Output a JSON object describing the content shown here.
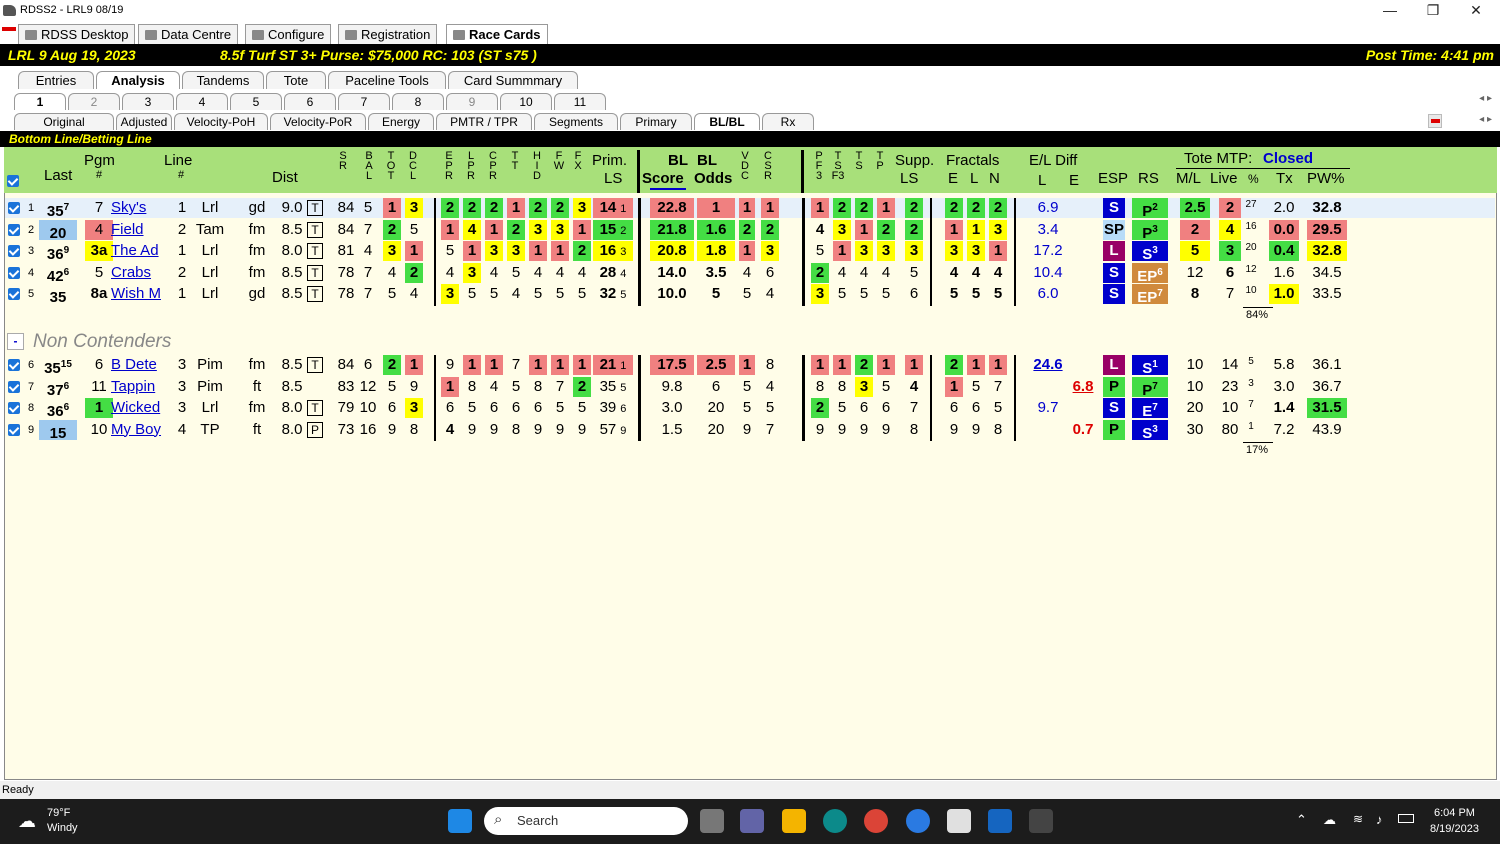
{
  "window": {
    "title": "RDSS2 - LRL9  08/19",
    "min": "—",
    "max": "❐",
    "close": "✕"
  },
  "main_tabs": [
    "RDSS Desktop",
    "Data Centre",
    "Configure",
    "Registration",
    "Race Cards"
  ],
  "race": {
    "track_race": "LRL  9  Aug 19, 2023",
    "conditions": "8.5f  Turf  ST  3+   Purse: $75,000   RC: 103  (ST s75 )",
    "post_time": "Post Time: 4:41 pm"
  },
  "view_tabs": [
    "Entries",
    "Analysis",
    "Tandems",
    "Tote",
    "Paceline Tools",
    "Card Summmary"
  ],
  "race_tabs": [
    "1",
    "2",
    "3",
    "4",
    "5",
    "6",
    "7",
    "8",
    "9",
    "10",
    "11"
  ],
  "analysis_tabs": [
    "Original",
    "Adjusted",
    "Velocity-PoH",
    "Velocity-PoR",
    "Energy",
    "PMTR / TPR",
    "Segments",
    "Primary",
    "BL/BL",
    "Rx"
  ],
  "section_title": "Bottom Line/Betting Line",
  "headers": {
    "last": "Last",
    "pgm": "Pgm",
    "pgm_hash": "#",
    "line": "Line",
    "line_hash": "#",
    "dist": "Dist",
    "sr": "S R",
    "bal": "B A L",
    "tot": "T O T",
    "dcl": "D C L",
    "epr": "E P R",
    "lpr": "L P R",
    "cpr": "C P R",
    "tt": "T T",
    "hid": "H I D",
    "fw": "F W",
    "fx": "F X",
    "prim": "Prim.",
    "prim_ls": "LS",
    "bl": "BL",
    "bl2": "BL",
    "score": "Score",
    "odds": "Odds",
    "vdc": "V D C",
    "csr": "C S R",
    "pf3": "P F 3",
    "tsf3": "T S F3",
    "ts": "T S",
    "tp": "T P",
    "supp": "Supp.",
    "supp_ls": "LS",
    "fractals": "Fractals",
    "e": "E",
    "l": "L",
    "n": "N",
    "eldiff": "E/L Diff",
    "eld_l": "L",
    "eld_e": "E",
    "esp": "ESP",
    "rs": "RS",
    "tote": "Tote MTP:",
    "tote_status": "Closed",
    "ml": "M/L",
    "live": "Live",
    "pct": "%",
    "tx": "Tx",
    "pw": "PW%"
  },
  "contenders": [
    {
      "n": "1",
      "last": "35",
      "last_sup": "7",
      "pgm": "7",
      "name": "Sky's",
      "line": "1",
      "trk": "Lrl",
      "cond": "gd",
      "dist": "9.0",
      "surf": "T",
      "sr": "84",
      "bal": "5",
      "tot": "1",
      "dcl": "3",
      "epr": "2",
      "lpr": "2",
      "cpr": "2",
      "tt": "1",
      "hid": "2",
      "fw": "2",
      "fx": "3",
      "prim": "14",
      "prim_r": "1",
      "score": "22.8",
      "odds": "1",
      "vdc": "1",
      "csr": "1",
      "pf3": "1",
      "tsf3": "2",
      "ts": "2",
      "tp": "1",
      "supp": "2",
      "fe": "2",
      "fl": "2",
      "fn": "2",
      "eld_l": "6.9",
      "eld_e": "",
      "esp": "S",
      "rs": "P",
      "rs_sup": "2",
      "ml": "2.5",
      "live": "2",
      "pct": "27",
      "tx": "2.0",
      "pw": "32.8"
    },
    {
      "n": "2",
      "last": "20",
      "last_sup": "",
      "pgm": "4",
      "name": "Field",
      "line": "2",
      "trk": "Tam",
      "cond": "fm",
      "dist": "8.5",
      "surf": "T",
      "sr": "84",
      "bal": "7",
      "tot": "2",
      "dcl": "5",
      "epr": "1",
      "lpr": "4",
      "cpr": "1",
      "tt": "2",
      "hid": "3",
      "fw": "3",
      "fx": "1",
      "prim": "15",
      "prim_r": "2",
      "score": "21.8",
      "odds": "1.6",
      "vdc": "2",
      "csr": "2",
      "pf3": "4",
      "tsf3": "3",
      "ts": "1",
      "tp": "2",
      "supp": "2",
      "fe": "1",
      "fl": "1",
      "fn": "3",
      "eld_l": "3.4",
      "eld_e": "",
      "esp": "SP",
      "rs": "P",
      "rs_sup": "3",
      "ml": "2",
      "live": "4",
      "pct": "16",
      "tx": "0.0",
      "pw": "29.5"
    },
    {
      "n": "3",
      "last": "36",
      "last_sup": "9",
      "pgm": "3a",
      "name": "The Ad",
      "line": "1",
      "trk": "Lrl",
      "cond": "fm",
      "dist": "8.0",
      "surf": "T",
      "sr": "81",
      "bal": "4",
      "tot": "3",
      "dcl": "1",
      "epr": "5",
      "lpr": "1",
      "cpr": "3",
      "tt": "3",
      "hid": "1",
      "fw": "1",
      "fx": "2",
      "prim": "16",
      "prim_r": "3",
      "score": "20.8",
      "odds": "1.8",
      "vdc": "1",
      "csr": "3",
      "pf3": "5",
      "tsf3": "1",
      "ts": "3",
      "tp": "3",
      "supp": "3",
      "fe": "3",
      "fl": "3",
      "fn": "1",
      "eld_l": "17.2",
      "eld_e": "",
      "esp": "L",
      "rs": "S",
      "rs_sup": "3",
      "ml": "5",
      "live": "3",
      "pct": "20",
      "tx": "0.4",
      "pw": "32.8"
    },
    {
      "n": "4",
      "last": "42",
      "last_sup": "6",
      "pgm": "5",
      "name": "Crabs",
      "line": "2",
      "trk": "Lrl",
      "cond": "fm",
      "dist": "8.5",
      "surf": "T",
      "sr": "78",
      "bal": "7",
      "tot": "4",
      "dcl": "2",
      "epr": "4",
      "lpr": "3",
      "cpr": "4",
      "tt": "5",
      "hid": "4",
      "fw": "4",
      "fx": "4",
      "prim": "28",
      "prim_r": "4",
      "score": "14.0",
      "odds": "3.5",
      "vdc": "4",
      "csr": "6",
      "pf3": "2",
      "tsf3": "4",
      "ts": "4",
      "tp": "4",
      "supp": "5",
      "fe": "4",
      "fl": "4",
      "fn": "4",
      "eld_l": "10.4",
      "eld_e": "",
      "esp": "S",
      "rs": "EP",
      "rs_sup": "6",
      "ml": "12",
      "live": "6",
      "pct": "12",
      "tx": "1.6",
      "pw": "34.5"
    },
    {
      "n": "5",
      "last": "35",
      "last_sup": "",
      "pgm": "8a",
      "name": "Wish M",
      "line": "1",
      "trk": "Lrl",
      "cond": "gd",
      "dist": "8.5",
      "surf": "T",
      "sr": "78",
      "bal": "7",
      "tot": "5",
      "dcl": "4",
      "epr": "3",
      "lpr": "5",
      "cpr": "5",
      "tt": "4",
      "hid": "5",
      "fw": "5",
      "fx": "5",
      "prim": "32",
      "prim_r": "5",
      "score": "10.0",
      "odds": "5",
      "vdc": "5",
      "csr": "4",
      "pf3": "3",
      "tsf3": "5",
      "ts": "5",
      "tp": "5",
      "supp": "6",
      "fe": "5",
      "fl": "5",
      "fn": "5",
      "eld_l": "6.0",
      "eld_e": "",
      "esp": "S",
      "rs": "EP",
      "rs_sup": "7",
      "ml": "8",
      "live": "7",
      "pct": "10",
      "tx": "1.0",
      "pw": "33.5"
    }
  ],
  "contender_pct_total": "84%",
  "non_contenders_label": "Non Contenders",
  "collapse_btn": "-",
  "non_contenders": [
    {
      "n": "6",
      "last": "35",
      "last_sup": "15",
      "pgm": "6",
      "name": "B Dete",
      "line": "3",
      "trk": "Pim",
      "cond": "fm",
      "dist": "8.5",
      "surf": "T",
      "sr": "84",
      "bal": "6",
      "tot": "2",
      "dcl": "1",
      "epr": "9",
      "lpr": "1",
      "cpr": "1",
      "tt": "7",
      "hid": "1",
      "fw": "1",
      "fx": "1",
      "prim": "21",
      "prim_r": "1",
      "score": "17.5",
      "odds": "2.5",
      "vdc": "1",
      "csr": "8",
      "pf3": "1",
      "tsf3": "1",
      "ts": "2",
      "tp": "1",
      "supp": "1",
      "fe": "2",
      "fl": "1",
      "fn": "1",
      "eld_l": "24.6",
      "eld_e": "",
      "esp": "L",
      "rs": "S",
      "rs_sup": "1",
      "ml": "10",
      "live": "14",
      "pct": "5",
      "tx": "5.8",
      "pw": "36.1"
    },
    {
      "n": "7",
      "last": "37",
      "last_sup": "6",
      "pgm": "11",
      "name": "Tappin",
      "line": "3",
      "trk": "Pim",
      "cond": "ft",
      "dist": "8.5",
      "surf": "",
      "sr": "83",
      "bal": "12",
      "tot": "5",
      "dcl": "9",
      "epr": "1",
      "lpr": "8",
      "cpr": "4",
      "tt": "5",
      "hid": "8",
      "fw": "7",
      "fx": "2",
      "prim": "35",
      "prim_r": "5",
      "score": "9.8",
      "odds": "6",
      "vdc": "5",
      "csr": "4",
      "pf3": "8",
      "tsf3": "8",
      "ts": "3",
      "tp": "5",
      "supp": "4",
      "fe": "1",
      "fl": "5",
      "fn": "7",
      "eld_l": "",
      "eld_e": "6.8",
      "esp": "P",
      "rs": "P",
      "rs_sup": "7",
      "ml": "10",
      "live": "23",
      "pct": "3",
      "tx": "3.0",
      "pw": "36.7"
    },
    {
      "n": "8",
      "last": "36",
      "last_sup": "6",
      "pgm": "1",
      "name": "Wicked",
      "line": "3",
      "trk": "Lrl",
      "cond": "fm",
      "dist": "8.0",
      "surf": "T",
      "sr": "79",
      "bal": "10",
      "tot": "6",
      "dcl": "3",
      "epr": "6",
      "lpr": "5",
      "cpr": "6",
      "tt": "6",
      "hid": "6",
      "fw": "5",
      "fx": "5",
      "prim": "39",
      "prim_r": "6",
      "score": "3.0",
      "odds": "20",
      "vdc": "5",
      "csr": "5",
      "pf3": "2",
      "tsf3": "5",
      "ts": "6",
      "tp": "6",
      "supp": "7",
      "fe": "6",
      "fl": "6",
      "fn": "5",
      "eld_l": "9.7",
      "eld_e": "",
      "esp": "S",
      "rs": "E",
      "rs_sup": "7",
      "ml": "20",
      "live": "10",
      "pct": "7",
      "tx": "1.4",
      "pw": "31.5"
    },
    {
      "n": "9",
      "last": "15",
      "last_sup": "",
      "pgm": "10",
      "name": "My Boy",
      "line": "4",
      "trk": "TP",
      "cond": "ft",
      "dist": "8.0",
      "surf": "P",
      "sr": "73",
      "bal": "16",
      "tot": "9",
      "dcl": "8",
      "epr": "4",
      "lpr": "9",
      "cpr": "9",
      "tt": "8",
      "hid": "9",
      "fw": "9",
      "fx": "9",
      "prim": "57",
      "prim_r": "9",
      "score": "1.5",
      "odds": "20",
      "vdc": "9",
      "csr": "7",
      "pf3": "9",
      "tsf3": "9",
      "ts": "9",
      "tp": "9",
      "supp": "8",
      "fe": "9",
      "fl": "9",
      "fn": "8",
      "eld_l": "",
      "eld_e": "0.7",
      "esp": "P",
      "rs": "S",
      "rs_sup": "3",
      "ml": "30",
      "live": "80",
      "pct": "1",
      "tx": "7.2",
      "pw": "43.9"
    }
  ],
  "noncontender_pct_total": "17%",
  "status": "Ready",
  "taskbar": {
    "temp": "79°F",
    "weather": "Windy",
    "search": "Search",
    "time": "6:04 PM",
    "date": "8/19/2023"
  },
  "colors": {
    "header_green": "#a8e07a",
    "content_bg": "#fffde8",
    "race_bar": "#000000",
    "race_text": "#ffff00",
    "red_cell": "#f08080",
    "yellow_cell": "#ffff00",
    "green_cell": "#44dd44"
  }
}
